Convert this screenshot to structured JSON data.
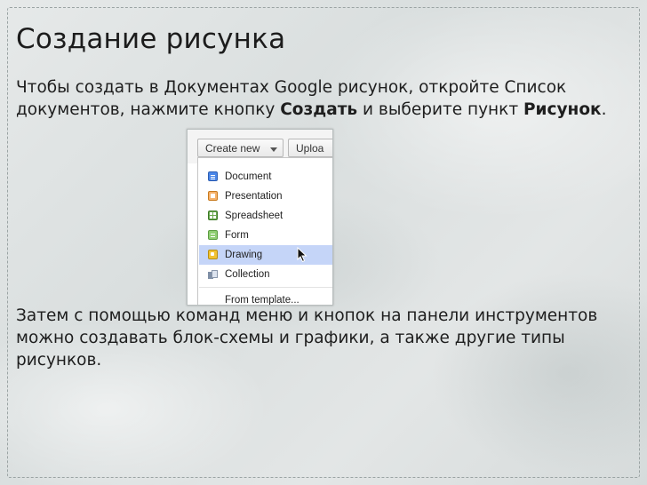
{
  "slide": {
    "title": "Создание рисунка",
    "intro_text_1": "Чтобы создать в Документах Google рисунок, откройте Список документов, нажмите кнопку ",
    "intro_bold_1": "Создать",
    "intro_text_2": " и выберите пункт ",
    "intro_bold_2": "Рисунок",
    "intro_text_3": ".",
    "outro_text": "Затем с помощью команд меню и кнопок на панели инструментов можно создавать блок-схемы и графики, а также другие типы рисунков."
  },
  "screenshot": {
    "create_button_label": "Create new",
    "upload_button_label": "Uploa",
    "menu_items": [
      {
        "label": "Document",
        "icon": "document-icon",
        "color": "#4a86e8"
      },
      {
        "label": "Presentation",
        "icon": "presentation-icon",
        "color": "#f6b26b"
      },
      {
        "label": "Spreadsheet",
        "icon": "spreadsheet-icon",
        "color": "#6aa84f"
      },
      {
        "label": "Form",
        "icon": "form-icon",
        "color": "#8fce72"
      },
      {
        "label": "Drawing",
        "icon": "drawing-icon",
        "color": "#f1c232",
        "highlighted": true
      },
      {
        "label": "Collection",
        "icon": "collection-icon",
        "color": "#7f8fa6"
      },
      {
        "label": "From template...",
        "icon": null
      }
    ],
    "highlight_color": "#c5d5f8"
  }
}
